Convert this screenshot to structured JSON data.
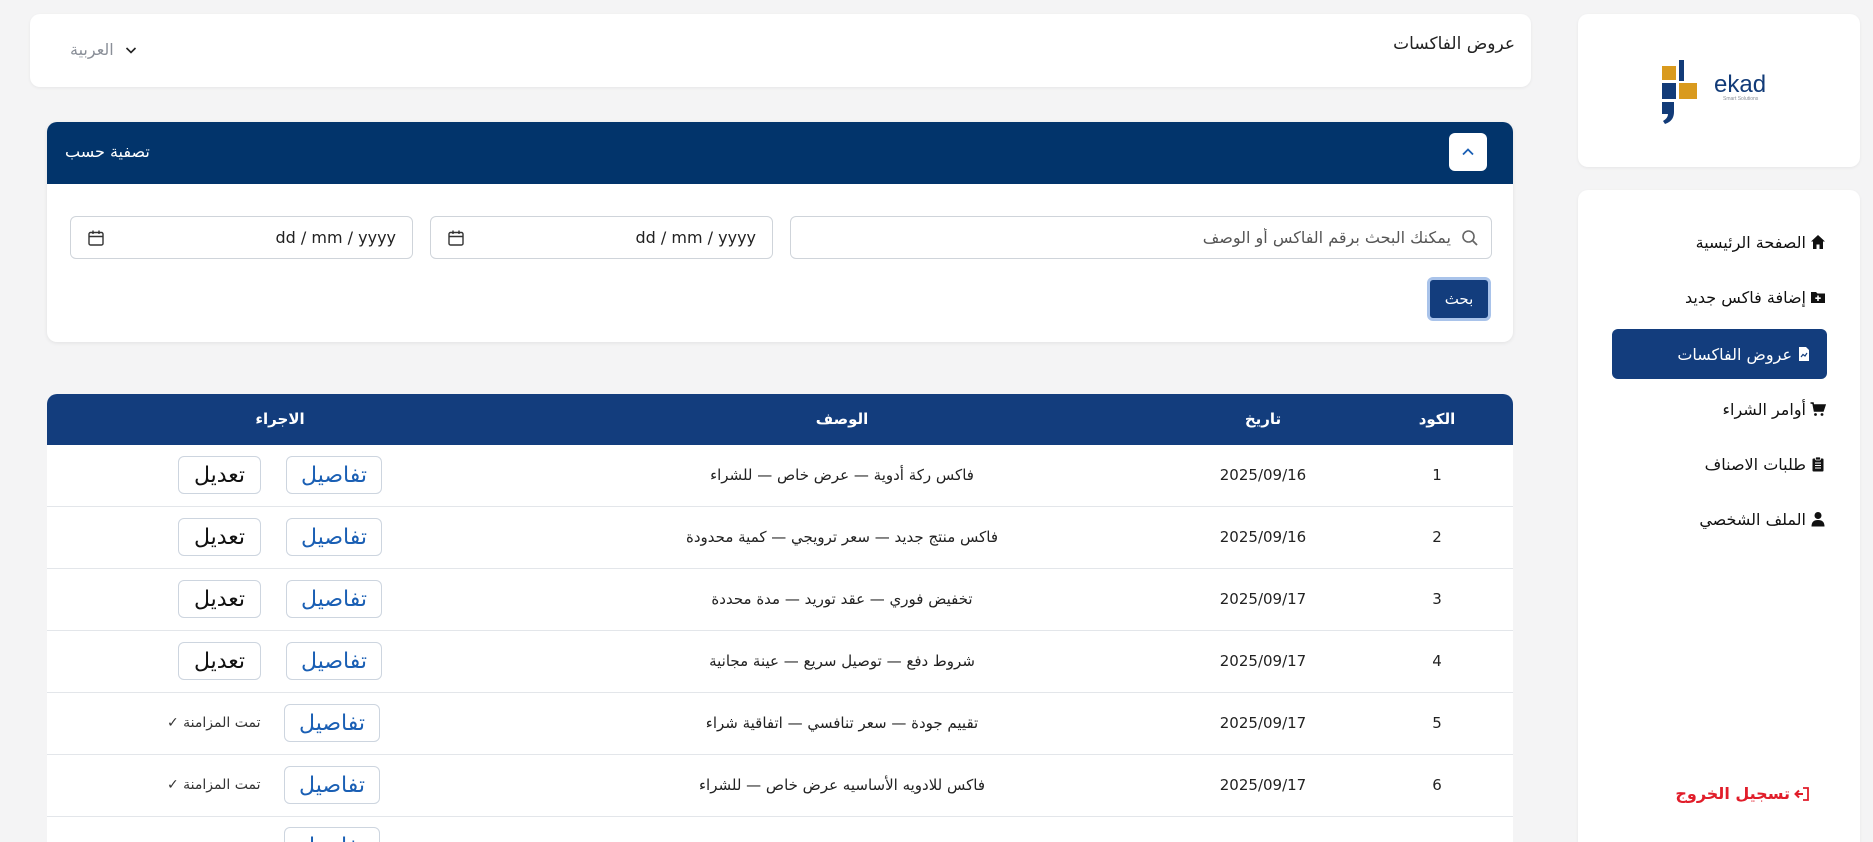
{
  "sidebar": {
    "logo_text": "ekad",
    "logo_subtext": "Smart Solutions",
    "items": [
      {
        "label": "الصفحة الرئيسية",
        "icon": "home-icon",
        "active": false
      },
      {
        "label": "إضافة فاكس جديد",
        "icon": "folder-plus-icon",
        "active": false
      },
      {
        "label": "عروض الفاكسات",
        "icon": "file-chart-icon",
        "active": true
      },
      {
        "label": "أوامر الشراء",
        "icon": "cart-icon",
        "active": false
      },
      {
        "label": "طلبات الاصناف",
        "icon": "clipboard-list-icon",
        "active": false
      },
      {
        "label": "الملف الشخصي",
        "icon": "user-icon",
        "active": false
      }
    ],
    "logout_label": "تسجيل الخروج"
  },
  "header": {
    "title": "عروض الفاكسات",
    "language": "العربية"
  },
  "filter": {
    "title": "تصفية حسب",
    "search_placeholder": "يمكنك البحث برقم الفاكس أو الوصف",
    "date_from_placeholder": "dd / mm / yyyy",
    "date_to_placeholder": "dd / mm / yyyy",
    "search_button": "بحث"
  },
  "table": {
    "columns": {
      "code": "الكود",
      "date": "تاريخ",
      "description": "الوصف",
      "actions": "الاجراء"
    },
    "details_label": "تفاصيل",
    "edit_label": "تعديل",
    "synced_label": "تمت المزامنة ✓",
    "rows": [
      {
        "code": "1",
        "date": "2025/09/16",
        "description": "فاكس ركة أدوية — عرض خاص — للشراء",
        "status": "editable"
      },
      {
        "code": "2",
        "date": "2025/09/16",
        "description": "فاكس منتج جديد — سعر ترويجي — كمية محدودة",
        "status": "editable"
      },
      {
        "code": "3",
        "date": "2025/09/17",
        "description": "تخفيض فوري — عقد توريد — مدة محددة",
        "status": "editable"
      },
      {
        "code": "4",
        "date": "2025/09/17",
        "description": "شروط دفع — توصيل سريع — عينة مجانية",
        "status": "editable"
      },
      {
        "code": "5",
        "date": "2025/09/17",
        "description": "تقييم جودة — سعر تنافسي — اتفاقية شراء",
        "status": "synced"
      },
      {
        "code": "6",
        "date": "2025/09/17",
        "description": "فاكس للادويه الأساسيه عرض خاص — للشراء",
        "status": "synced"
      }
    ]
  },
  "colors": {
    "primary": "#133d7d",
    "filter_header": "#02346b",
    "logout": "#e11d2a",
    "link": "#1a5fb4",
    "logo_orange": "#d99a1e",
    "logo_navy": "#123b78"
  }
}
